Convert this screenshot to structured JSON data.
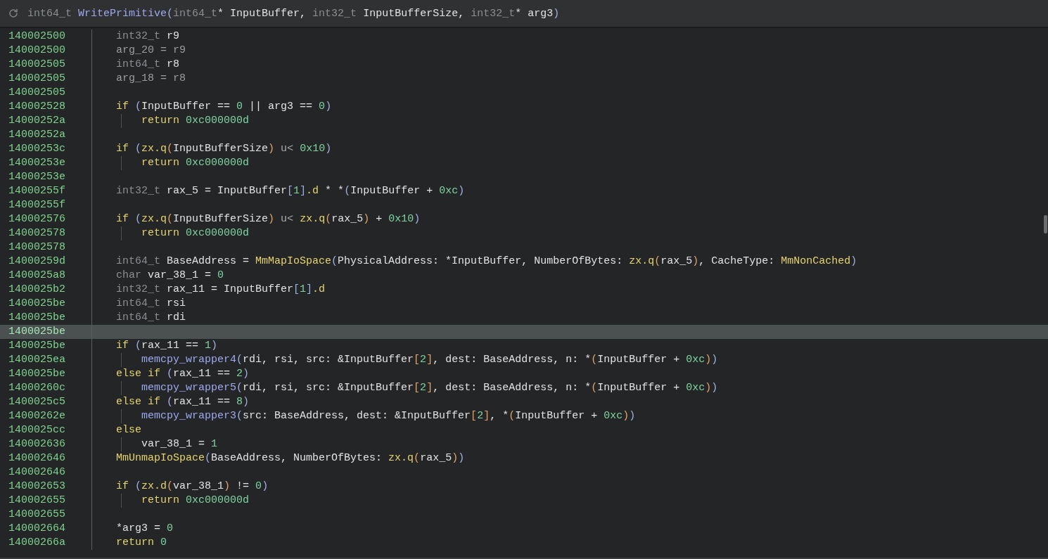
{
  "header": {
    "tokens": [
      {
        "kind": "type",
        "text": "int64_t "
      },
      {
        "kind": "func",
        "text": "WritePrimitive"
      },
      {
        "kind": "paren",
        "text": "("
      },
      {
        "kind": "type",
        "text": "int64_t"
      },
      {
        "kind": "var",
        "text": "* InputBuffer, "
      },
      {
        "kind": "type",
        "text": "int32_t "
      },
      {
        "kind": "var",
        "text": "InputBufferSize, "
      },
      {
        "kind": "type",
        "text": "int32_t"
      },
      {
        "kind": "var",
        "text": "* arg3"
      },
      {
        "kind": "paren",
        "text": ")"
      }
    ]
  },
  "lines": [
    {
      "address": "140002500",
      "selected": false,
      "tokens": [
        {
          "kind": "type",
          "text": "int32_t "
        },
        {
          "kind": "var",
          "text": "r9"
        }
      ]
    },
    {
      "address": "140002500",
      "selected": false,
      "tokens": [
        {
          "kind": "dim",
          "text": "arg_20 = r9"
        }
      ]
    },
    {
      "address": "140002505",
      "selected": false,
      "tokens": [
        {
          "kind": "type",
          "text": "int64_t "
        },
        {
          "kind": "var",
          "text": "r8"
        }
      ]
    },
    {
      "address": "140002505",
      "selected": false,
      "tokens": [
        {
          "kind": "dim",
          "text": "arg_18 = r8"
        }
      ]
    },
    {
      "address": "140002505",
      "selected": false
    },
    {
      "address": "140002528",
      "selected": false,
      "tokens": [
        {
          "kind": "keyword",
          "text": "if "
        },
        {
          "kind": "paren",
          "text": "("
        },
        {
          "kind": "var",
          "text": "InputBuffer == "
        },
        {
          "kind": "number",
          "text": "0"
        },
        {
          "kind": "var",
          "text": " || arg3 == "
        },
        {
          "kind": "number",
          "text": "0"
        },
        {
          "kind": "paren",
          "text": ")"
        }
      ],
      "children": [
        {
          "address": "14000252a",
          "selected": false,
          "tokens": [
            {
              "kind": "keyword",
              "text": "return "
            },
            {
              "kind": "number",
              "text": "0xc000000d"
            }
          ]
        }
      ]
    },
    {
      "address": "14000252a",
      "selected": false
    },
    {
      "address": "14000253c",
      "selected": false,
      "tokens": [
        {
          "kind": "keyword",
          "text": "if "
        },
        {
          "kind": "paren",
          "text": "("
        },
        {
          "kind": "call",
          "text": "zx.q"
        },
        {
          "kind": "bracket",
          "text": "("
        },
        {
          "kind": "var",
          "text": "InputBufferSize"
        },
        {
          "kind": "bracket",
          "text": ")"
        },
        {
          "kind": "op",
          "text": " u< "
        },
        {
          "kind": "number",
          "text": "0x10"
        },
        {
          "kind": "paren",
          "text": ")"
        }
      ],
      "children": [
        {
          "address": "14000253e",
          "selected": false,
          "tokens": [
            {
              "kind": "keyword",
              "text": "return "
            },
            {
              "kind": "number",
              "text": "0xc000000d"
            }
          ]
        }
      ]
    },
    {
      "address": "14000253e",
      "selected": false
    },
    {
      "address": "14000255f",
      "selected": false,
      "tokens": [
        {
          "kind": "type",
          "text": "int32_t "
        },
        {
          "kind": "var",
          "text": "rax_5 = InputBuffer"
        },
        {
          "kind": "paren",
          "text": "["
        },
        {
          "kind": "number",
          "text": "1"
        },
        {
          "kind": "paren",
          "text": "]"
        },
        {
          "kind": "call",
          "text": ".d"
        },
        {
          "kind": "var",
          "text": " * *"
        },
        {
          "kind": "paren",
          "text": "("
        },
        {
          "kind": "var",
          "text": "InputBuffer + "
        },
        {
          "kind": "number",
          "text": "0xc"
        },
        {
          "kind": "paren",
          "text": ")"
        }
      ]
    },
    {
      "address": "14000255f",
      "selected": false
    },
    {
      "address": "140002576",
      "selected": false,
      "tokens": [
        {
          "kind": "keyword",
          "text": "if "
        },
        {
          "kind": "paren",
          "text": "("
        },
        {
          "kind": "call",
          "text": "zx.q"
        },
        {
          "kind": "bracket",
          "text": "("
        },
        {
          "kind": "var",
          "text": "InputBufferSize"
        },
        {
          "kind": "bracket",
          "text": ")"
        },
        {
          "kind": "op",
          "text": " u< "
        },
        {
          "kind": "call",
          "text": "zx.q"
        },
        {
          "kind": "bracket",
          "text": "("
        },
        {
          "kind": "var",
          "text": "rax_5"
        },
        {
          "kind": "bracket",
          "text": ")"
        },
        {
          "kind": "var",
          "text": " + "
        },
        {
          "kind": "number",
          "text": "0x10"
        },
        {
          "kind": "paren",
          "text": ")"
        }
      ],
      "children": [
        {
          "address": "140002578",
          "selected": false,
          "tokens": [
            {
              "kind": "keyword",
              "text": "return "
            },
            {
              "kind": "number",
              "text": "0xc000000d"
            }
          ]
        }
      ]
    },
    {
      "address": "140002578",
      "selected": false
    },
    {
      "address": "14000259d",
      "selected": false,
      "tokens": [
        {
          "kind": "type",
          "text": "int64_t "
        },
        {
          "kind": "var",
          "text": "BaseAddress = "
        },
        {
          "kind": "call",
          "text": "MmMapIoSpace"
        },
        {
          "kind": "paren",
          "text": "("
        },
        {
          "kind": "var",
          "text": "PhysicalAddress: *InputBuffer, NumberOfBytes: "
        },
        {
          "kind": "call",
          "text": "zx.q"
        },
        {
          "kind": "bracket",
          "text": "("
        },
        {
          "kind": "var",
          "text": "rax_5"
        },
        {
          "kind": "bracket",
          "text": ")"
        },
        {
          "kind": "var",
          "text": ", CacheType: "
        },
        {
          "kind": "call",
          "text": "MmNonCached"
        },
        {
          "kind": "paren",
          "text": ")"
        }
      ]
    },
    {
      "address": "1400025a8",
      "selected": false,
      "tokens": [
        {
          "kind": "type",
          "text": "char "
        },
        {
          "kind": "var",
          "text": "var_38_1 = "
        },
        {
          "kind": "number",
          "text": "0"
        }
      ]
    },
    {
      "address": "1400025b2",
      "selected": false,
      "tokens": [
        {
          "kind": "type",
          "text": "int32_t "
        },
        {
          "kind": "var",
          "text": "rax_11 = InputBuffer"
        },
        {
          "kind": "paren",
          "text": "["
        },
        {
          "kind": "number",
          "text": "1"
        },
        {
          "kind": "paren",
          "text": "]"
        },
        {
          "kind": "call",
          "text": ".d"
        }
      ]
    },
    {
      "address": "1400025be",
      "selected": false,
      "tokens": [
        {
          "kind": "type",
          "text": "int64_t "
        },
        {
          "kind": "var",
          "text": "rsi"
        }
      ]
    },
    {
      "address": "1400025be",
      "selected": false,
      "tokens": [
        {
          "kind": "type",
          "text": "int64_t "
        },
        {
          "kind": "var",
          "text": "rdi"
        }
      ]
    },
    {
      "address": "1400025be",
      "selected": true
    },
    {
      "address": "1400025be",
      "selected": false,
      "tokens": [
        {
          "kind": "keyword",
          "text": "if "
        },
        {
          "kind": "paren",
          "text": "("
        },
        {
          "kind": "var",
          "text": "rax_11 == "
        },
        {
          "kind": "number",
          "text": "1"
        },
        {
          "kind": "paren",
          "text": ")"
        }
      ],
      "children": [
        {
          "address": "1400025ea",
          "selected": false,
          "tokens": [
            {
              "kind": "func",
              "text": "memcpy_wrapper4"
            },
            {
              "kind": "paren",
              "text": "("
            },
            {
              "kind": "var",
              "text": "rdi, rsi, src: &InputBuffer"
            },
            {
              "kind": "bracket",
              "text": "["
            },
            {
              "kind": "number",
              "text": "2"
            },
            {
              "kind": "bracket",
              "text": "]"
            },
            {
              "kind": "var",
              "text": ", dest: BaseAddress, n: *"
            },
            {
              "kind": "bracket",
              "text": "("
            },
            {
              "kind": "var",
              "text": "InputBuffer + "
            },
            {
              "kind": "number",
              "text": "0xc"
            },
            {
              "kind": "bracket",
              "text": ")"
            },
            {
              "kind": "paren",
              "text": ")"
            }
          ]
        }
      ]
    },
    {
      "address": "1400025be",
      "selected": false,
      "tokens": [
        {
          "kind": "keyword",
          "text": "else if "
        },
        {
          "kind": "paren",
          "text": "("
        },
        {
          "kind": "var",
          "text": "rax_11 == "
        },
        {
          "kind": "number",
          "text": "2"
        },
        {
          "kind": "paren",
          "text": ")"
        }
      ],
      "children": [
        {
          "address": "14000260c",
          "selected": false,
          "tokens": [
            {
              "kind": "func",
              "text": "memcpy_wrapper5"
            },
            {
              "kind": "paren",
              "text": "("
            },
            {
              "kind": "var",
              "text": "rdi, rsi, src: &InputBuffer"
            },
            {
              "kind": "bracket",
              "text": "["
            },
            {
              "kind": "number",
              "text": "2"
            },
            {
              "kind": "bracket",
              "text": "]"
            },
            {
              "kind": "var",
              "text": ", dest: BaseAddress, n: *"
            },
            {
              "kind": "bracket",
              "text": "("
            },
            {
              "kind": "var",
              "text": "InputBuffer + "
            },
            {
              "kind": "number",
              "text": "0xc"
            },
            {
              "kind": "bracket",
              "text": ")"
            },
            {
              "kind": "paren",
              "text": ")"
            }
          ]
        }
      ]
    },
    {
      "address": "1400025c5",
      "selected": false,
      "tokens": [
        {
          "kind": "keyword",
          "text": "else if "
        },
        {
          "kind": "paren",
          "text": "("
        },
        {
          "kind": "var",
          "text": "rax_11 == "
        },
        {
          "kind": "number",
          "text": "8"
        },
        {
          "kind": "paren",
          "text": ")"
        }
      ],
      "children": [
        {
          "address": "14000262e",
          "selected": false,
          "tokens": [
            {
              "kind": "func",
              "text": "memcpy_wrapper3"
            },
            {
              "kind": "paren",
              "text": "("
            },
            {
              "kind": "var",
              "text": "src: BaseAddress, dest: &InputBuffer"
            },
            {
              "kind": "bracket",
              "text": "["
            },
            {
              "kind": "number",
              "text": "2"
            },
            {
              "kind": "bracket",
              "text": "]"
            },
            {
              "kind": "var",
              "text": ", *"
            },
            {
              "kind": "bracket",
              "text": "("
            },
            {
              "kind": "var",
              "text": "InputBuffer + "
            },
            {
              "kind": "number",
              "text": "0xc"
            },
            {
              "kind": "bracket",
              "text": ")"
            },
            {
              "kind": "paren",
              "text": ")"
            }
          ]
        }
      ]
    },
    {
      "address": "1400025cc",
      "selected": false,
      "tokens": [
        {
          "kind": "keyword",
          "text": "else"
        }
      ],
      "children": [
        {
          "address": "140002636",
          "selected": false,
          "tokens": [
            {
              "kind": "var",
              "text": "var_38_1 = "
            },
            {
              "kind": "number",
              "text": "1"
            }
          ]
        }
      ]
    },
    {
      "address": "140002646",
      "selected": false,
      "tokens": [
        {
          "kind": "call",
          "text": "MmUnmapIoSpace"
        },
        {
          "kind": "paren",
          "text": "("
        },
        {
          "kind": "var",
          "text": "BaseAddress, NumberOfBytes: "
        },
        {
          "kind": "call",
          "text": "zx.q"
        },
        {
          "kind": "bracket",
          "text": "("
        },
        {
          "kind": "var",
          "text": "rax_5"
        },
        {
          "kind": "bracket",
          "text": ")"
        },
        {
          "kind": "paren",
          "text": ")"
        }
      ]
    },
    {
      "address": "140002646",
      "selected": false
    },
    {
      "address": "140002653",
      "selected": false,
      "tokens": [
        {
          "kind": "keyword",
          "text": "if "
        },
        {
          "kind": "paren",
          "text": "("
        },
        {
          "kind": "call",
          "text": "zx.d"
        },
        {
          "kind": "bracket",
          "text": "("
        },
        {
          "kind": "var",
          "text": "var_38_1"
        },
        {
          "kind": "bracket",
          "text": ")"
        },
        {
          "kind": "var",
          "text": " != "
        },
        {
          "kind": "number",
          "text": "0"
        },
        {
          "kind": "paren",
          "text": ")"
        }
      ],
      "children": [
        {
          "address": "140002655",
          "selected": false,
          "tokens": [
            {
              "kind": "keyword",
              "text": "return "
            },
            {
              "kind": "number",
              "text": "0xc000000d"
            }
          ]
        }
      ]
    },
    {
      "address": "140002655",
      "selected": false
    },
    {
      "address": "140002664",
      "selected": false,
      "tokens": [
        {
          "kind": "var",
          "text": "*arg3 = "
        },
        {
          "kind": "number",
          "text": "0"
        }
      ]
    },
    {
      "address": "14000266a",
      "selected": false,
      "tokens": [
        {
          "kind": "keyword",
          "text": "return "
        },
        {
          "kind": "number",
          "text": "0"
        }
      ]
    }
  ]
}
